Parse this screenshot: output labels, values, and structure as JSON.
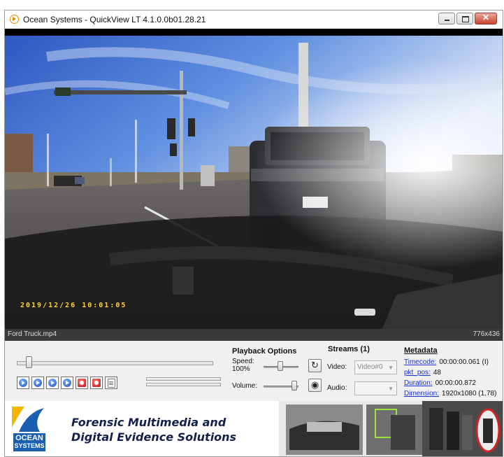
{
  "window": {
    "title": "Ocean Systems - QuickView LT 4.1.0.0b01.28.21",
    "buttons": {
      "minimize": "–",
      "maximize": "□",
      "close": "✕"
    }
  },
  "video": {
    "timestamp": "2019/12/26  10:01:05"
  },
  "infobar": {
    "filename": "Ford Truck.mp4",
    "dimensions": "776x436"
  },
  "playback": {
    "heading": "Playback Options",
    "speed_label": "Speed:",
    "speed_value": "100%",
    "volume_label": "Volume:",
    "buttons": [
      "rewind-start-icon",
      "play-icon",
      "step-forward-icon",
      "fast-forward-icon",
      "snapshot-icon",
      "record-icon",
      "document-icon"
    ]
  },
  "streams": {
    "heading": "Streams (1)",
    "video_label": "Video:",
    "video_value": "Video#0",
    "audio_label": "Audio:",
    "audio_value": ""
  },
  "metadata": {
    "heading": "Metadata",
    "rows": [
      {
        "key": "Timecode:",
        "value": "00:00:00.061 (I)",
        "link": true
      },
      {
        "key": "pkt_pos:",
        "value": "48",
        "link": true
      },
      {
        "key": "Duration:",
        "value": "00:00:00.872",
        "link": true
      },
      {
        "key": "Dimension:",
        "value": "1920x1080 (1.78)",
        "link": true
      }
    ]
  },
  "banner": {
    "logo_line1": "OCEAN",
    "logo_line2": "SYSTEMS",
    "tagline_line1": "Forensic Multimedia and",
    "tagline_line2": "Digital Evidence Solutions"
  },
  "colors": {
    "link": "#1a33cc",
    "timestamp": "#ffd23a",
    "logo_blue": "#1a5fb0",
    "logo_yellow": "#f5b400"
  }
}
